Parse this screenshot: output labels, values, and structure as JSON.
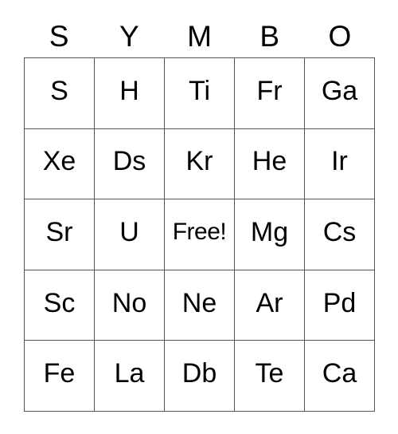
{
  "card": {
    "header_letters": [
      "S",
      "Y",
      "M",
      "B",
      "O"
    ],
    "rows": [
      [
        "S",
        "H",
        "Ti",
        "Fr",
        "Ga"
      ],
      [
        "Xe",
        "Ds",
        "Kr",
        "He",
        "Ir"
      ],
      [
        "Sr",
        "U",
        "Free!",
        "Mg",
        "Cs"
      ],
      [
        "Sc",
        "No",
        "Ne",
        "Ar",
        "Pd"
      ],
      [
        "Fe",
        "La",
        "Db",
        "Te",
        "Ca"
      ]
    ],
    "free_space": {
      "label": "Free!",
      "row": 2,
      "col": 2
    },
    "colors": {
      "background": "#ffffff",
      "text": "#000000",
      "grid_line": "#555555"
    },
    "grid_size": "5x5"
  }
}
